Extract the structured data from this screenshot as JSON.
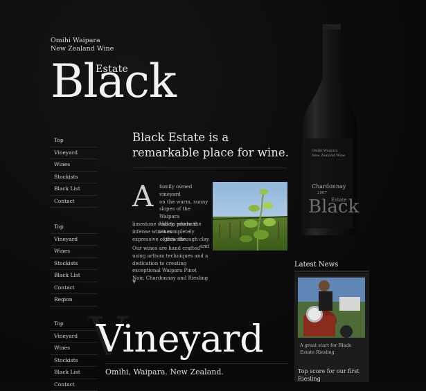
{
  "brand": {
    "tagline_line1": "Omihi Waipara",
    "tagline_line2": "New Zealand Wine",
    "logo_small": "Estate",
    "logo_big": "Black"
  },
  "nav_groups": [
    [
      "Top",
      "Vineyard",
      "Wines",
      "Stockists",
      "Black List",
      "Contact"
    ],
    [
      "Top",
      "Vineyard",
      "Wines",
      "Stockists",
      "Black List",
      "Contact",
      "Region"
    ],
    [
      "Top",
      "Vineyard",
      "Wines",
      "Stockists",
      "Black List",
      "Contact"
    ]
  ],
  "intro": {
    "headline": "Black Estate is a remarkable place for wine.",
    "dropcap": "A",
    "lines_beside_dropcap": [
      "family owned vineyard",
      "on the warm, sunny",
      "slopes of the Waipara",
      "Valley, where the vines",
      "grow through clay and"
    ],
    "rest": "limestone soils to produce intense wines completely expressive of this site.",
    "paragraph2": "Our wines are hand crafted using artisan techniques and a dedication to creating exceptional Waipara Pinot Noir, Chardonnay and Riesling",
    "more": "▼"
  },
  "bottle_label": {
    "line1": "Omihi Waipara",
    "line2": "New Zealand Wine",
    "variety": "Chardonnay",
    "year": "2007",
    "small": "Estate",
    "big": "Black"
  },
  "news": {
    "heading": "Latest News",
    "item1": "A great start for Black Estate Riesling",
    "item2": "Top score for our first Riesling"
  },
  "section": {
    "big_letter": "V",
    "title": "Vineyard",
    "subtitle": "Omihi, Waipara. New Zealand."
  },
  "colors": {
    "background": "#0b0b0b",
    "text": "#cfcfcf",
    "accent_white": "#f2f2f2",
    "news_box": "#1c1c1c"
  }
}
